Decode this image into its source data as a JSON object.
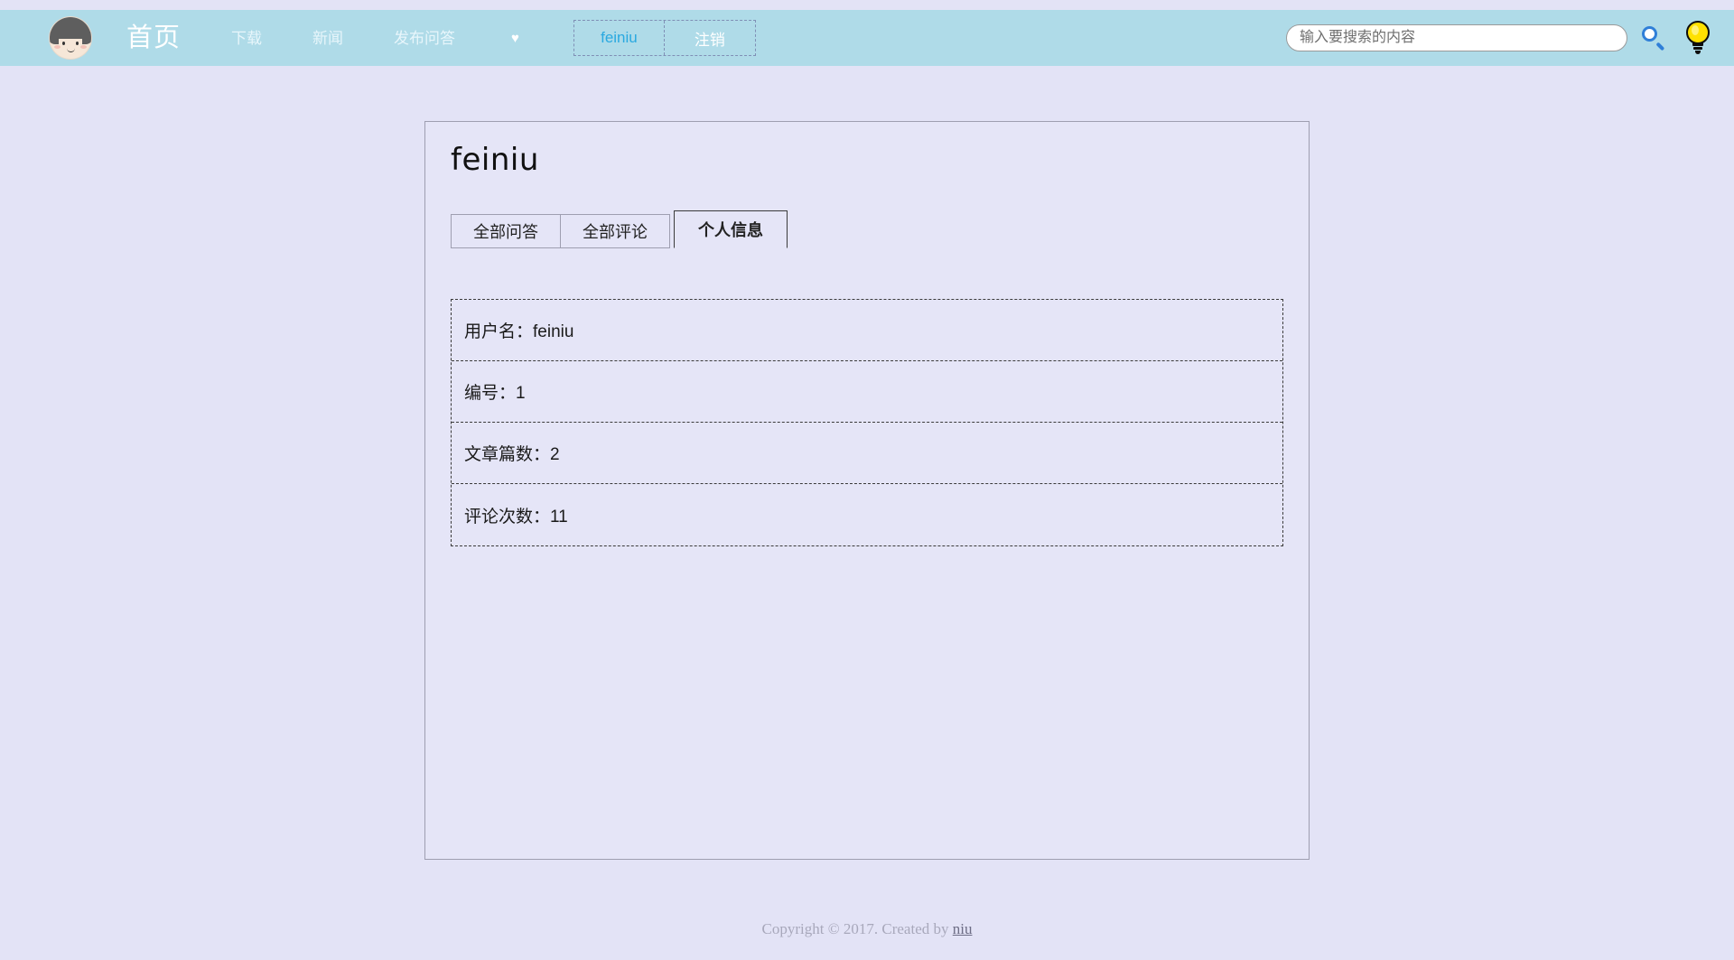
{
  "colors": {
    "page_background": "#e3e3f6",
    "navbar_background": "#afdbe8",
    "accent_link": "#2aa9e0",
    "bulb_yellow": "#ffe100",
    "search_icon_blue": "#2f7fd8"
  },
  "navbar": {
    "avatar_alt": "user-avatar",
    "home_label": "首页",
    "links": [
      {
        "label": "下载"
      },
      {
        "label": "新闻"
      },
      {
        "label": "发布问答"
      }
    ],
    "heart_glyph": "♥",
    "user": {
      "name_label": "feiniu",
      "logout_label": "注销"
    },
    "search": {
      "placeholder": "输入要搜索的内容",
      "value": "",
      "search_icon_name": "search-icon",
      "bulb_icon_name": "lightbulb-icon"
    }
  },
  "card": {
    "title": "feiniu",
    "tabs": [
      {
        "label": "全部问答",
        "active": false
      },
      {
        "label": "全部评论",
        "active": false
      },
      {
        "label": "个人信息",
        "active": true
      }
    ],
    "info_rows": [
      {
        "text": "用户名：feiniu"
      },
      {
        "text": "编号：1"
      },
      {
        "text": "文章篇数：2"
      },
      {
        "text": "评论次数：11"
      }
    ]
  },
  "footer": {
    "text": "Copyright © 2017. Created by ",
    "author": "niu"
  }
}
